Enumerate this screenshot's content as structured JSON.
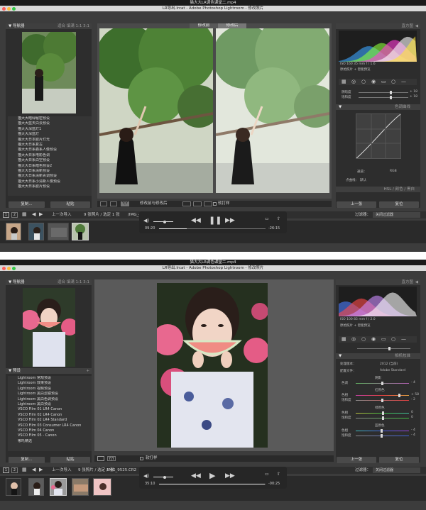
{
  "shotA": {
    "mac_title": "猫大大LR调色课堂二.mp4",
    "lr_title": "LR导出.lrcat - Adobe Photoshop Lightroom - 修改照片",
    "left": {
      "navigator_title": "导航器",
      "navigator_modes": "适合  填满  1:1  3:1",
      "presets": [
        "猫大大暗绿秘密预设",
        "猫大大蓝天白云预设",
        "猫大大深蓝灯1",
        "猫大大深蓝灯",
        "猫大大日本胶片灯光",
        "猫大大日系复古",
        "猫大大日系森系人像预设",
        "猫大大日系电影色调",
        "猫大大日系白空预设",
        "猫大大日系暗色预设2",
        "猫大大日系清新预设",
        "猫大大日系清新青调预设",
        "猫大大日系小清新人像预设",
        "猫大大日系胶片预设"
      ],
      "copy": "复制...",
      "paste": "粘贴"
    },
    "center": {
      "before_label": "修改前",
      "after_label": "修改后",
      "compare_label": "修改前与修改后",
      "softproof": "软打样"
    },
    "right": {
      "histogram_title": "直方图",
      "hist_info": "ISO 160    35 mm    f / 1.6",
      "original_photo": "原始照片 + 智能预览",
      "slider_labels": [
        "阴暗度",
        "饱和度"
      ],
      "slider_values": [
        "+ 18",
        "+ 18"
      ],
      "tonecurve_title": "色调曲线",
      "curve_channel": "通道：",
      "curve_value": "RGB",
      "point_curve": "点曲线：",
      "point_curve_value": "默认",
      "hsl_title": "HSL / 颜色 / 黑白",
      "prev": "上一张",
      "reset": "复位"
    },
    "filmstrip": {
      "info": "上一次导入",
      "count": "9 张照片 / 选定 1 张",
      "filename": "/IMG_4558-2.CR2",
      "filter_label": "过滤器：",
      "filter_value": "关闭过滤器"
    },
    "player": {
      "current": "09:20",
      "remaining": "-26:15",
      "progress": 0.26
    },
    "histogram_colors": [
      "#3aa5ff",
      "#8cff3a",
      "#ff3ad7",
      "#ffffff",
      "#ffe43a"
    ]
  },
  "shotB": {
    "mac_title": "猫大大LR调色课堂二.mp4",
    "lr_title": "LR导出.lrcat - Adobe Photoshop Lightroom - 修改照片",
    "left": {
      "navigator_title": "导航器",
      "navigator_modes": "适合  填满  1:1  3:1",
      "presets_title": "预设",
      "presets": [
        "Lightroom 常规预设",
        "Lightroom 效果预设",
        "Lightroom 视频预设",
        "Lightroom 黑白滤镜预设",
        "Lightroom 黑白色调预设",
        "Lightroom 黑白预设",
        "VSCO Film 01 LR4 Canon",
        "VSCO Film 02 LR4 Canon",
        "VSCO Film 02 LR4 Standard",
        "VSCO Film 03 Consumer LR4 Canon",
        "VSCO Film 04 Canon",
        "VSCO Film 05 - Canon",
        "哪吒精选"
      ],
      "copy": "复制...",
      "paste": "粘贴"
    },
    "center": {
      "softproof": "软打样"
    },
    "right": {
      "histogram_title": "直方图",
      "hist_info": "ISO 100    85 mm    f / 2.0",
      "original_photo": "原始照片 + 智能预览",
      "calib_title": "相机校准",
      "process_label": "处理版本：",
      "process_value": "2012 (当前)",
      "profile_label": "配置文件：",
      "profile_value": "Adobe Standard",
      "shadow_title": "阴影",
      "tint_label": "色调",
      "tint_value": "- 4",
      "red_title": "红原色",
      "red_hue_label": "色相",
      "red_hue_value": "+ 58",
      "red_sat_label": "饱和度",
      "red_sat_value": "- 2",
      "green_title": "绿原色",
      "green_hue_label": "色相",
      "green_hue_value": "0",
      "green_sat_label": "饱和度",
      "green_sat_value": "0",
      "blue_title": "蓝原色",
      "blue_hue_label": "色相",
      "blue_hue_value": "- 4",
      "blue_sat_label": "饱和度",
      "blue_sat_value": "- 4",
      "prev": "上一张",
      "reset": "复位"
    },
    "filmstrip": {
      "info": "上一次导入",
      "count": "9 张照片 / 选定 1 张",
      "filename": "/IMG_9525.CR2",
      "filter_label": "过滤器：",
      "filter_value": "关闭过滤器"
    },
    "player": {
      "current": "35:10",
      "remaining": "-00:25",
      "progress": 0.99
    },
    "histogram_colors": [
      "#4a7bff",
      "#ff4a4a",
      "#cc8cff",
      "#ffffff"
    ]
  }
}
